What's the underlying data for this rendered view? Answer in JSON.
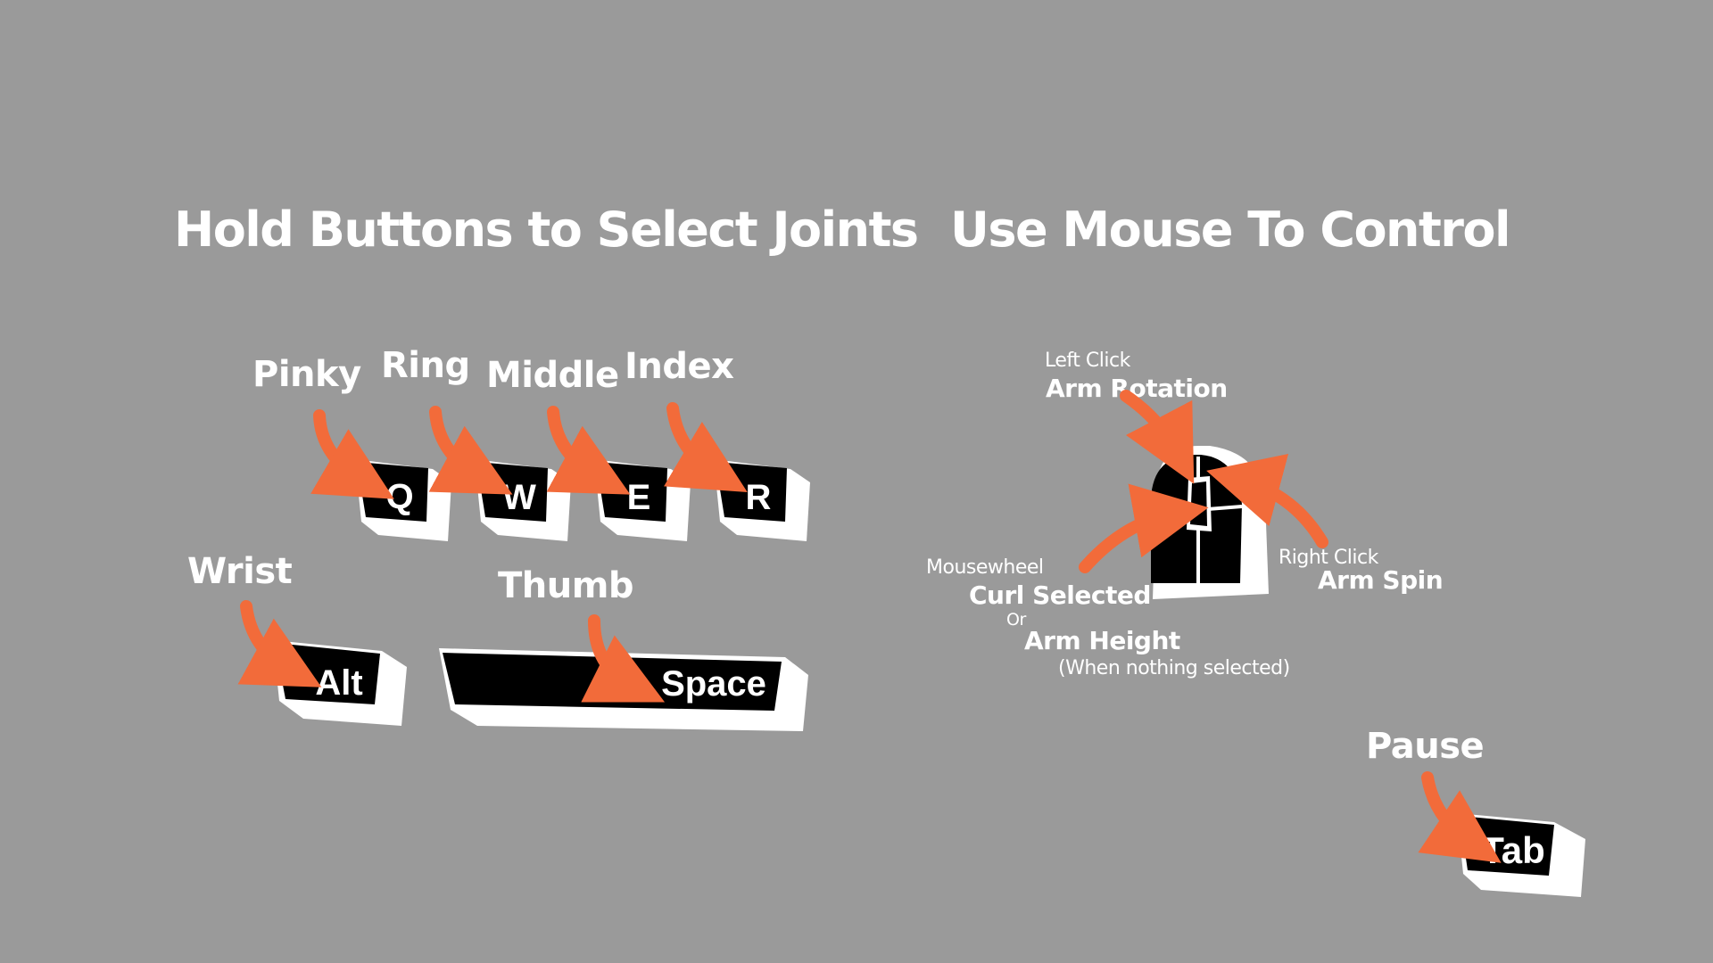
{
  "headings": {
    "left": "Hold Buttons to Select Joints",
    "right": "Use Mouse To Control"
  },
  "fingers": {
    "pinky": "Pinky",
    "ring": "Ring",
    "middle": "Middle",
    "index": "Index",
    "wrist": "Wrist",
    "thumb": "Thumb"
  },
  "keys": {
    "q": "Q",
    "w": "W",
    "e": "E",
    "r": "R",
    "alt": "Alt",
    "space": "Space",
    "tab": "Tab"
  },
  "mouse": {
    "left_click": "Left Click",
    "left_action": "Arm Rotation",
    "right_click": "Right Click",
    "right_action": "Arm Spin",
    "wheel": "Mousewheel",
    "wheel_action": "Curl Selected",
    "or": "Or",
    "wheel_alt_action": "Arm Height",
    "wheel_alt_note": "(When nothing selected)"
  },
  "pause": "Pause",
  "colors": {
    "background": "#9a9a9a",
    "arrow": "#f26b3a",
    "key_face": "#000000",
    "key_body": "#ffffff"
  }
}
